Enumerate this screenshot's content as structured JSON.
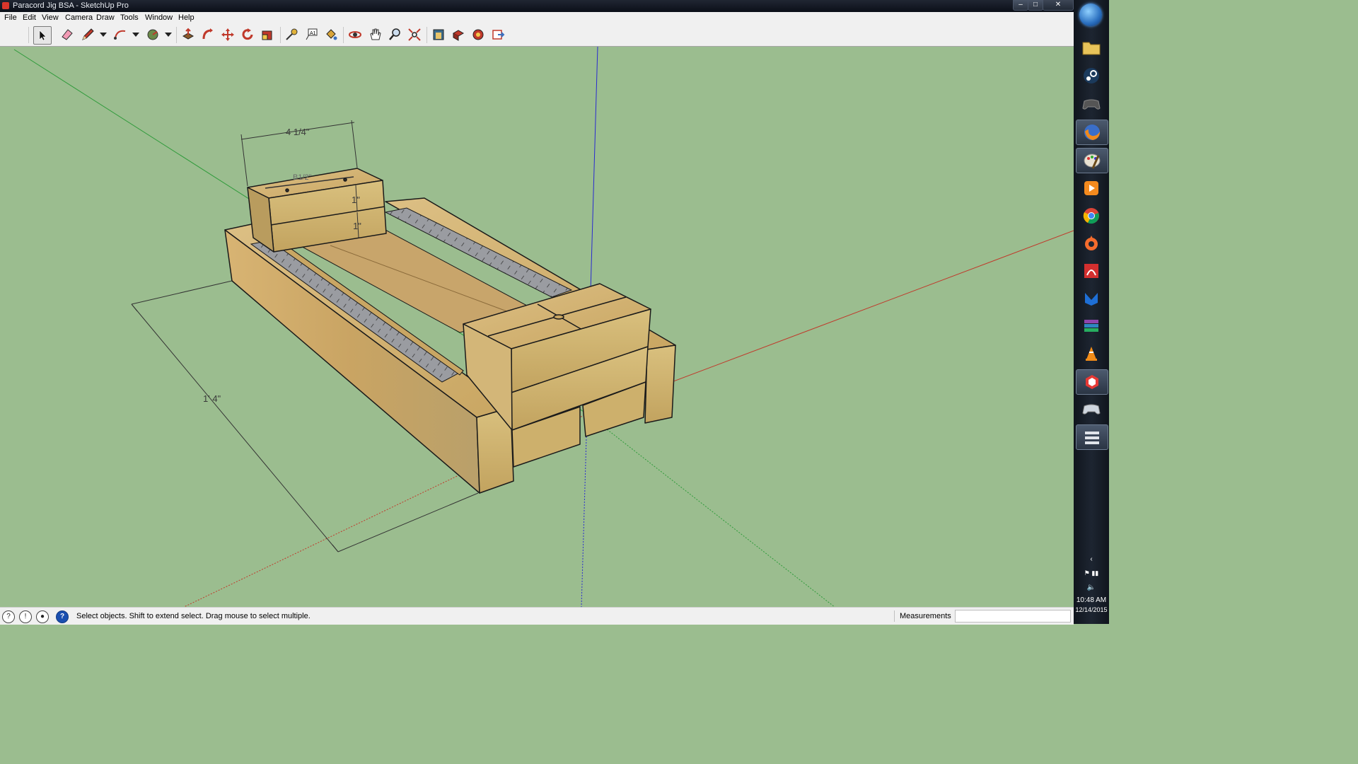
{
  "window": {
    "title": "Paracord Jig BSA - SketchUp Pro",
    "controls": {
      "minimize": "–",
      "maximize": "□",
      "close": "✕"
    }
  },
  "menu": [
    "File",
    "Edit",
    "View",
    "Camera",
    "Draw",
    "Tools",
    "Window",
    "Help"
  ],
  "toolbar": {
    "tools": [
      {
        "name": "select-tool",
        "icon": "arrow-cursor-icon",
        "active": true
      },
      {
        "name": "eraser-tool",
        "icon": "eraser-icon"
      },
      {
        "name": "line-tool",
        "icon": "pencil-icon"
      },
      {
        "name": "arc-tool",
        "icon": "arc-icon"
      },
      {
        "name": "circle-tool",
        "icon": "circle-icon"
      },
      {
        "name": "push-pull-tool",
        "icon": "push-pull-icon"
      },
      {
        "name": "follow-me-tool",
        "icon": "follow-me-icon"
      },
      {
        "name": "move-tool",
        "icon": "move-icon"
      },
      {
        "name": "rotate-tool",
        "icon": "rotate-icon"
      },
      {
        "name": "scale-tool",
        "icon": "scale-icon"
      },
      {
        "name": "tape-measure-tool",
        "icon": "tape-measure-icon"
      },
      {
        "name": "text-tool",
        "icon": "text-icon"
      },
      {
        "name": "paint-bucket-tool",
        "icon": "paint-bucket-icon"
      },
      {
        "name": "orbit-tool",
        "icon": "orbit-icon"
      },
      {
        "name": "pan-tool",
        "icon": "hand-icon"
      },
      {
        "name": "zoom-tool",
        "icon": "magnifier-icon"
      },
      {
        "name": "zoom-extents-tool",
        "icon": "zoom-extents-icon"
      },
      {
        "name": "3d-warehouse-tool",
        "icon": "warehouse-icon"
      },
      {
        "name": "extension-warehouse-tool",
        "icon": "extension-icon"
      },
      {
        "name": "share-model-tool",
        "icon": "share-icon"
      },
      {
        "name": "send-to-layout-tool",
        "icon": "layout-icon"
      }
    ]
  },
  "viewport": {
    "dimensions": {
      "width_label": "4 1/4\"",
      "length_label": "1' 4\"",
      "height_top": "1\"",
      "height_bottom": "1\"",
      "small_label": "B1/2\""
    },
    "colors": {
      "background": "#9bbd8f",
      "axis_red": "#c0392b",
      "axis_green": "#2e9b3a",
      "axis_blue": "#2a2ad0",
      "wood": "#d6b46e",
      "ruler": "#9a9ca1"
    }
  },
  "status": {
    "message": "Select objects. Shift to extend select. Drag mouse to select multiple.",
    "measurements_label": "Measurements",
    "measurements_value": ""
  },
  "taskbar": {
    "time": "10:48 AM",
    "date": "12/14/2015",
    "apps": [
      "folder-icon",
      "steam-icon",
      "gamepad-icon",
      "firefox-icon",
      "paint-icon",
      "media-player-icon",
      "chrome-icon",
      "origin-icon",
      "acrobat-icon",
      "malwarebytes-icon",
      "winrar-icon",
      "vlc-icon",
      "sketchup-icon",
      "controller-icon",
      "network-tool-icon"
    ]
  }
}
